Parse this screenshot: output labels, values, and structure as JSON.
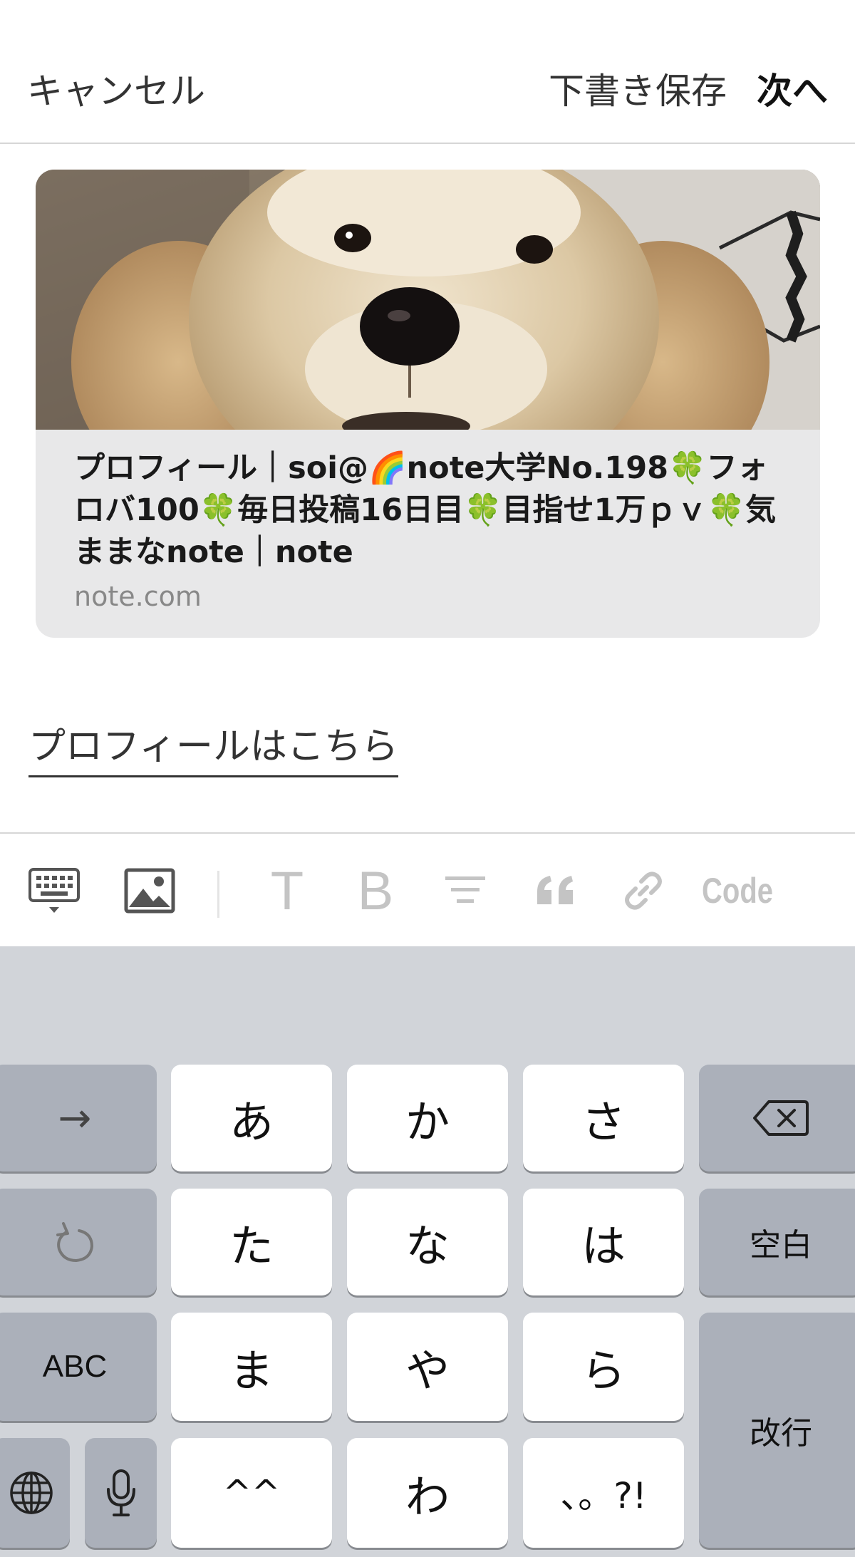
{
  "header": {
    "cancel_label": "キャンセル",
    "draft_label": "下書き保存",
    "next_label": "次へ"
  },
  "link_card": {
    "title": "プロフィール｜soi@🌈note大学No.198🍀フォロバ100🍀毎日投稿16日目🍀目指せ1万ｐｖ🍀気ままなnote｜note",
    "domain": "note.com",
    "image_icon": "dog-photo"
  },
  "body": {
    "link_text": "プロフィールはこちら"
  },
  "toolbar": {
    "items": [
      "keyboard-icon",
      "image-icon",
      "text-T-icon",
      "bold-B-icon",
      "align-icon",
      "quote-icon",
      "link-icon",
      "code"
    ],
    "text_label": "T",
    "bold_label": "B",
    "quote_label": "❝",
    "code_label": "Code"
  },
  "keyboard": {
    "row1": [
      "→",
      "あ",
      "か",
      "さ",
      "⌫"
    ],
    "row2": [
      "↺",
      "た",
      "な",
      "は",
      "空白"
    ],
    "row3": [
      "ABC",
      "ま",
      "や",
      "ら"
    ],
    "row4": [
      "🌐",
      "🎤",
      "^^",
      "わ",
      "、。?!"
    ],
    "return_label": "改行",
    "arrow_label": "→",
    "space_label": "空白",
    "abc_label": "ABC",
    "kana": {
      "a": "あ",
      "ka": "か",
      "sa": "さ",
      "ta": "た",
      "na": "な",
      "ha": "は",
      "ma": "ま",
      "ya": "や",
      "ra": "ら",
      "emoticon": "^^",
      "wa": "わ",
      "punct": "、。?!"
    }
  },
  "colors": {
    "keyboard_bg": "#d1d4d9",
    "key_white": "#ffffff",
    "key_gray": "#abb0ba",
    "card_bg": "#e8e8e9",
    "toolbar_icon": "#c4c4c4"
  }
}
